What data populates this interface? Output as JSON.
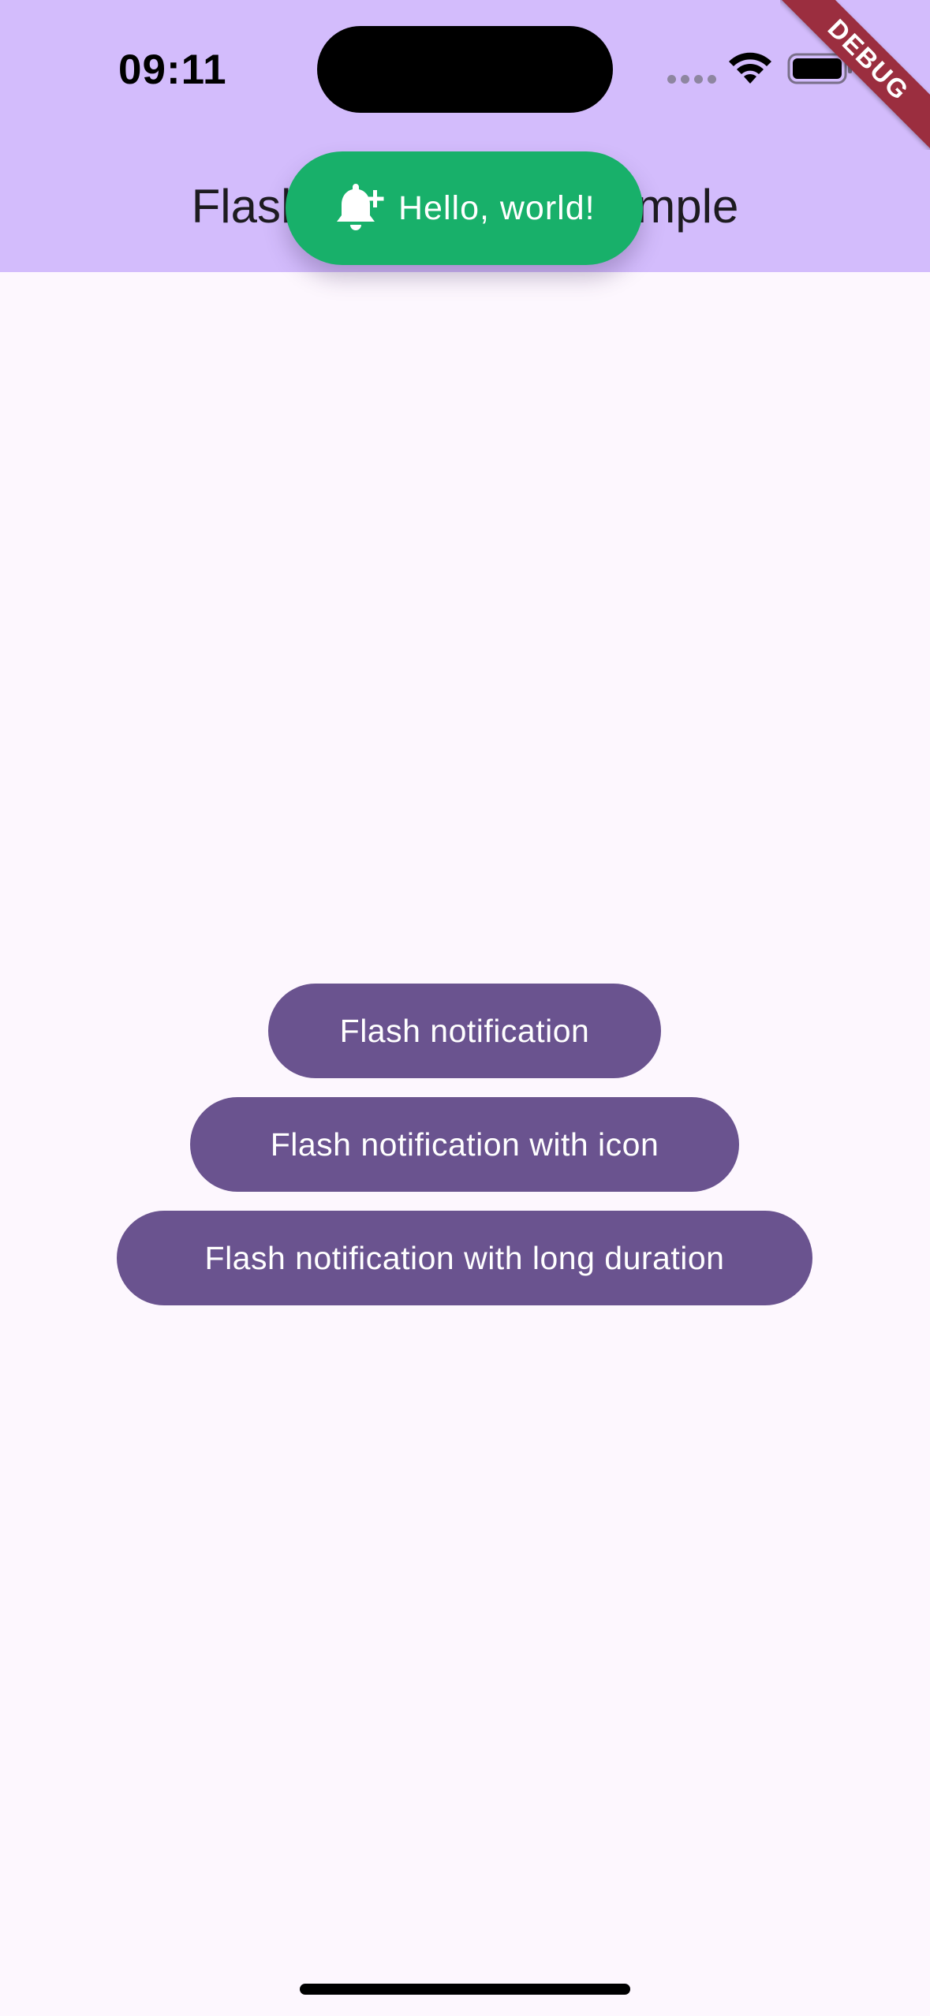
{
  "status_bar": {
    "time": "09:11"
  },
  "app_bar": {
    "title": "Flash notification example"
  },
  "debug_banner": "DEBUG",
  "toast": {
    "icon": "bell-plus-icon",
    "message": "Hello, world!",
    "color": "#18b06a"
  },
  "buttons": [
    {
      "label": "Flash notification"
    },
    {
      "label": "Flash notification with icon"
    },
    {
      "label": "Flash notification with long duration"
    }
  ],
  "colors": {
    "app_bar": "#d3bcfc",
    "background": "#fdf7fe",
    "button": "#6a538f"
  }
}
